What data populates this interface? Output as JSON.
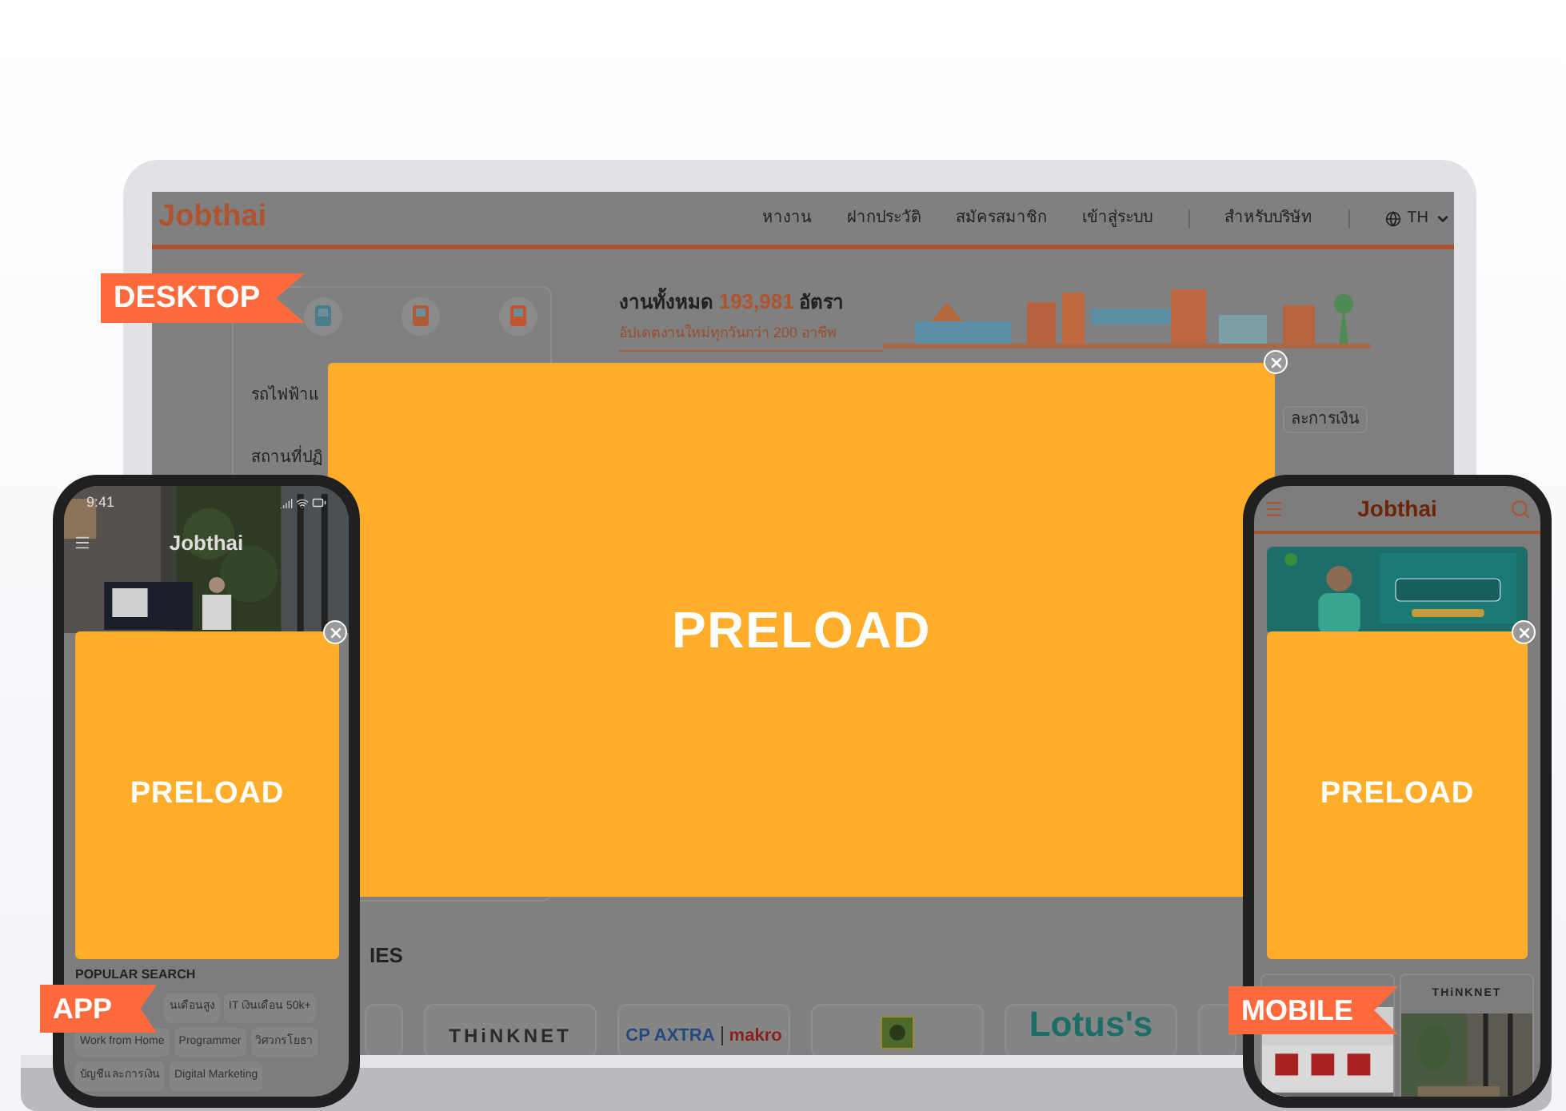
{
  "desktop": {
    "badge": "DESKTOP",
    "logo": "Jobthai",
    "nav": [
      {
        "label": "หางาน"
      },
      {
        "label": "ฝากประวัติ"
      },
      {
        "label": "สมัครสมาชิก"
      },
      {
        "label": "เข้าสู่ระบบ"
      },
      {
        "label": "สำหรับบริษัท"
      }
    ],
    "language": "TH",
    "hero": {
      "prefix": "งานทั้งหมด",
      "count": "193,981",
      "suffix": "อัตรา",
      "subtitle": "อัปเดตงานใหม่ทุกวันกว่า 200 อาชีพ"
    },
    "categories": [
      {
        "label": "รถไฟฟ้าแ"
      },
      {
        "label": "สถานที่ปฏิ"
      }
    ],
    "tag": "ละการเงิน",
    "section_title": "IES",
    "companies": [
      {
        "kind": "blank"
      },
      {
        "kind": "wordmark",
        "name": "THiNKNET"
      },
      {
        "kind": "pair",
        "name": "CP AXTRA",
        "partner": "makro"
      },
      {
        "kind": "emblem"
      },
      {
        "kind": "wordmark",
        "name": "Lotus's"
      },
      {
        "kind": "blank"
      }
    ],
    "ad": {
      "text": "PRELOAD"
    }
  },
  "app": {
    "badge": "APP",
    "time": "9:41",
    "logo": "Jobthai",
    "ad": {
      "text": "PRELOAD"
    },
    "popular_title": "POPULAR SEARCH",
    "chips": [
      {
        "label": "นเดือนสูง"
      },
      {
        "label": "IT เงินเดือน 50k+"
      },
      {
        "label": "Work from Home"
      },
      {
        "label": "Programmer"
      },
      {
        "label": "วิศวกรโยธา"
      },
      {
        "label": "บัญชีและการเงิน"
      },
      {
        "label": "Digital Marketing"
      }
    ]
  },
  "mobile": {
    "badge": "MOBILE",
    "logo": "Jobthai",
    "ad": {
      "text": "PRELOAD"
    },
    "tiles": [
      {
        "kind": "picture"
      },
      {
        "kind": "company",
        "name": "THiNKNET"
      }
    ]
  }
}
